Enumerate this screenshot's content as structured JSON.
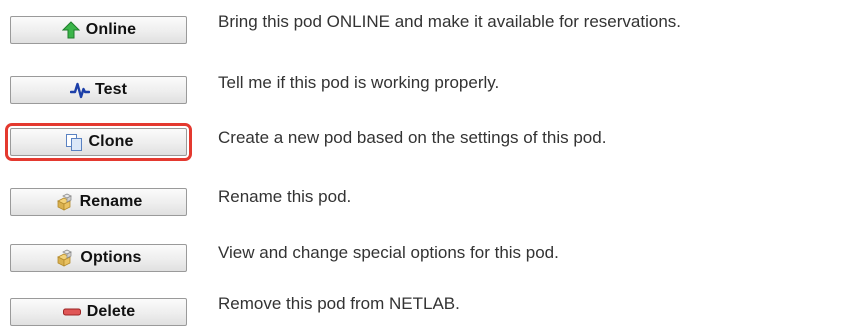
{
  "pod_actions": {
    "items": [
      {
        "key": "online",
        "button_label": "Online",
        "icon": "green-up-arrow-icon",
        "description": "Bring this pod ONLINE and make it available for reservations."
      },
      {
        "key": "test",
        "button_label": "Test",
        "icon": "pulse-wave-icon",
        "description": "Tell me if this pod is working properly."
      },
      {
        "key": "clone",
        "button_label": "Clone",
        "icon": "copy-pages-icon",
        "description": "Create a new pod based on the settings of this pod.",
        "highlighted": true,
        "highlight_color": "#e4392f"
      },
      {
        "key": "rename",
        "button_label": "Rename",
        "icon": "cubes-icon",
        "description": "Rename this pod."
      },
      {
        "key": "options",
        "button_label": "Options",
        "icon": "cubes-icon",
        "description": "View and change special options for this pod."
      },
      {
        "key": "delete",
        "button_label": "Delete",
        "icon": "red-minus-bar-icon",
        "description": "Remove this pod from NETLAB."
      }
    ]
  }
}
